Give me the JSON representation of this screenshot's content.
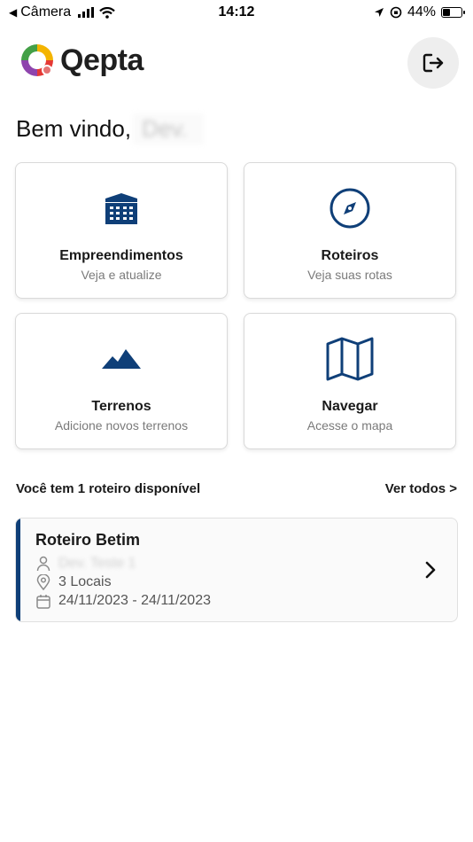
{
  "status_bar": {
    "back_app": "Câmera",
    "time": "14:12",
    "battery": "44%",
    "battery_level": 0.44
  },
  "header": {
    "brand": "Qepta",
    "logout_icon": "logout-icon"
  },
  "welcome": {
    "greeting": "Bem vindo,",
    "user_name": "Dev."
  },
  "menu": [
    {
      "title": "Empreendimentos",
      "subtitle": "Veja e atualize",
      "icon": "building-icon"
    },
    {
      "title": "Roteiros",
      "subtitle": "Veja suas rotas",
      "icon": "compass-icon"
    },
    {
      "title": "Terrenos",
      "subtitle": "Adicione novos terrenos",
      "icon": "mountain-icon"
    },
    {
      "title": "Navegar",
      "subtitle": "Acesse o mapa",
      "icon": "map-icon"
    }
  ],
  "routes_section": {
    "title": "Você tem 1 roteiro disponível",
    "see_all": "Ver todos >"
  },
  "routes": [
    {
      "name": "Roteiro Betim",
      "owner": "Dev. Teste 1",
      "locations": "3 Locais",
      "dates": "24/11/2023 - 24/11/2023"
    }
  ],
  "colors": {
    "primary": "#0f3f78",
    "card_border": "#d9d9d9",
    "muted_text": "#7a7a7a"
  }
}
